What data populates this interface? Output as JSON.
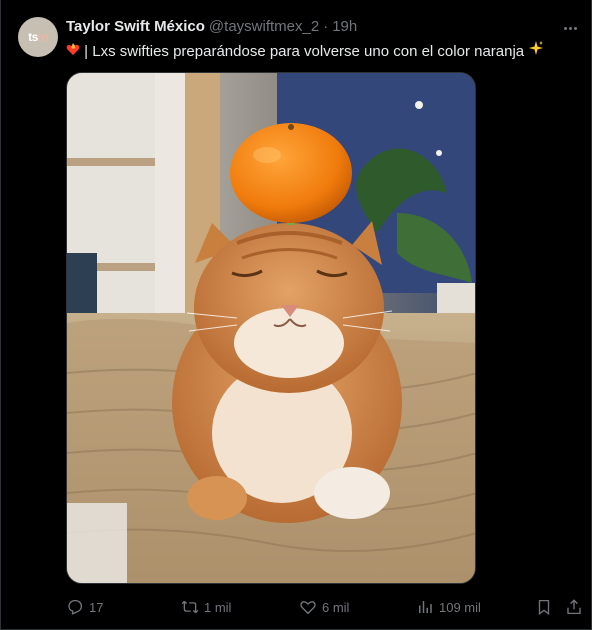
{
  "post": {
    "author_name": "Taylor Swift México",
    "handle": "@tayswiftmex_2",
    "separator": "·",
    "time": "19h",
    "avatar_text_a": "ts",
    "avatar_text_b": "m",
    "text": "| Lxs swifties preparándose para volverse uno con el color naranja",
    "lead_emoji": "heart-on-fire",
    "trail_emoji": "sparkles",
    "more_icon": "more-horizontal-icon"
  },
  "media": {
    "alt": "Orange cat with a tangerine on its head"
  },
  "actions": {
    "replies": "17",
    "reposts": "1 mil",
    "likes": "6 mil",
    "views": "109 mil"
  },
  "colors": {
    "background": "#000000",
    "text": "#e7e9ea",
    "muted": "#71767b",
    "border": "#2f3336"
  }
}
